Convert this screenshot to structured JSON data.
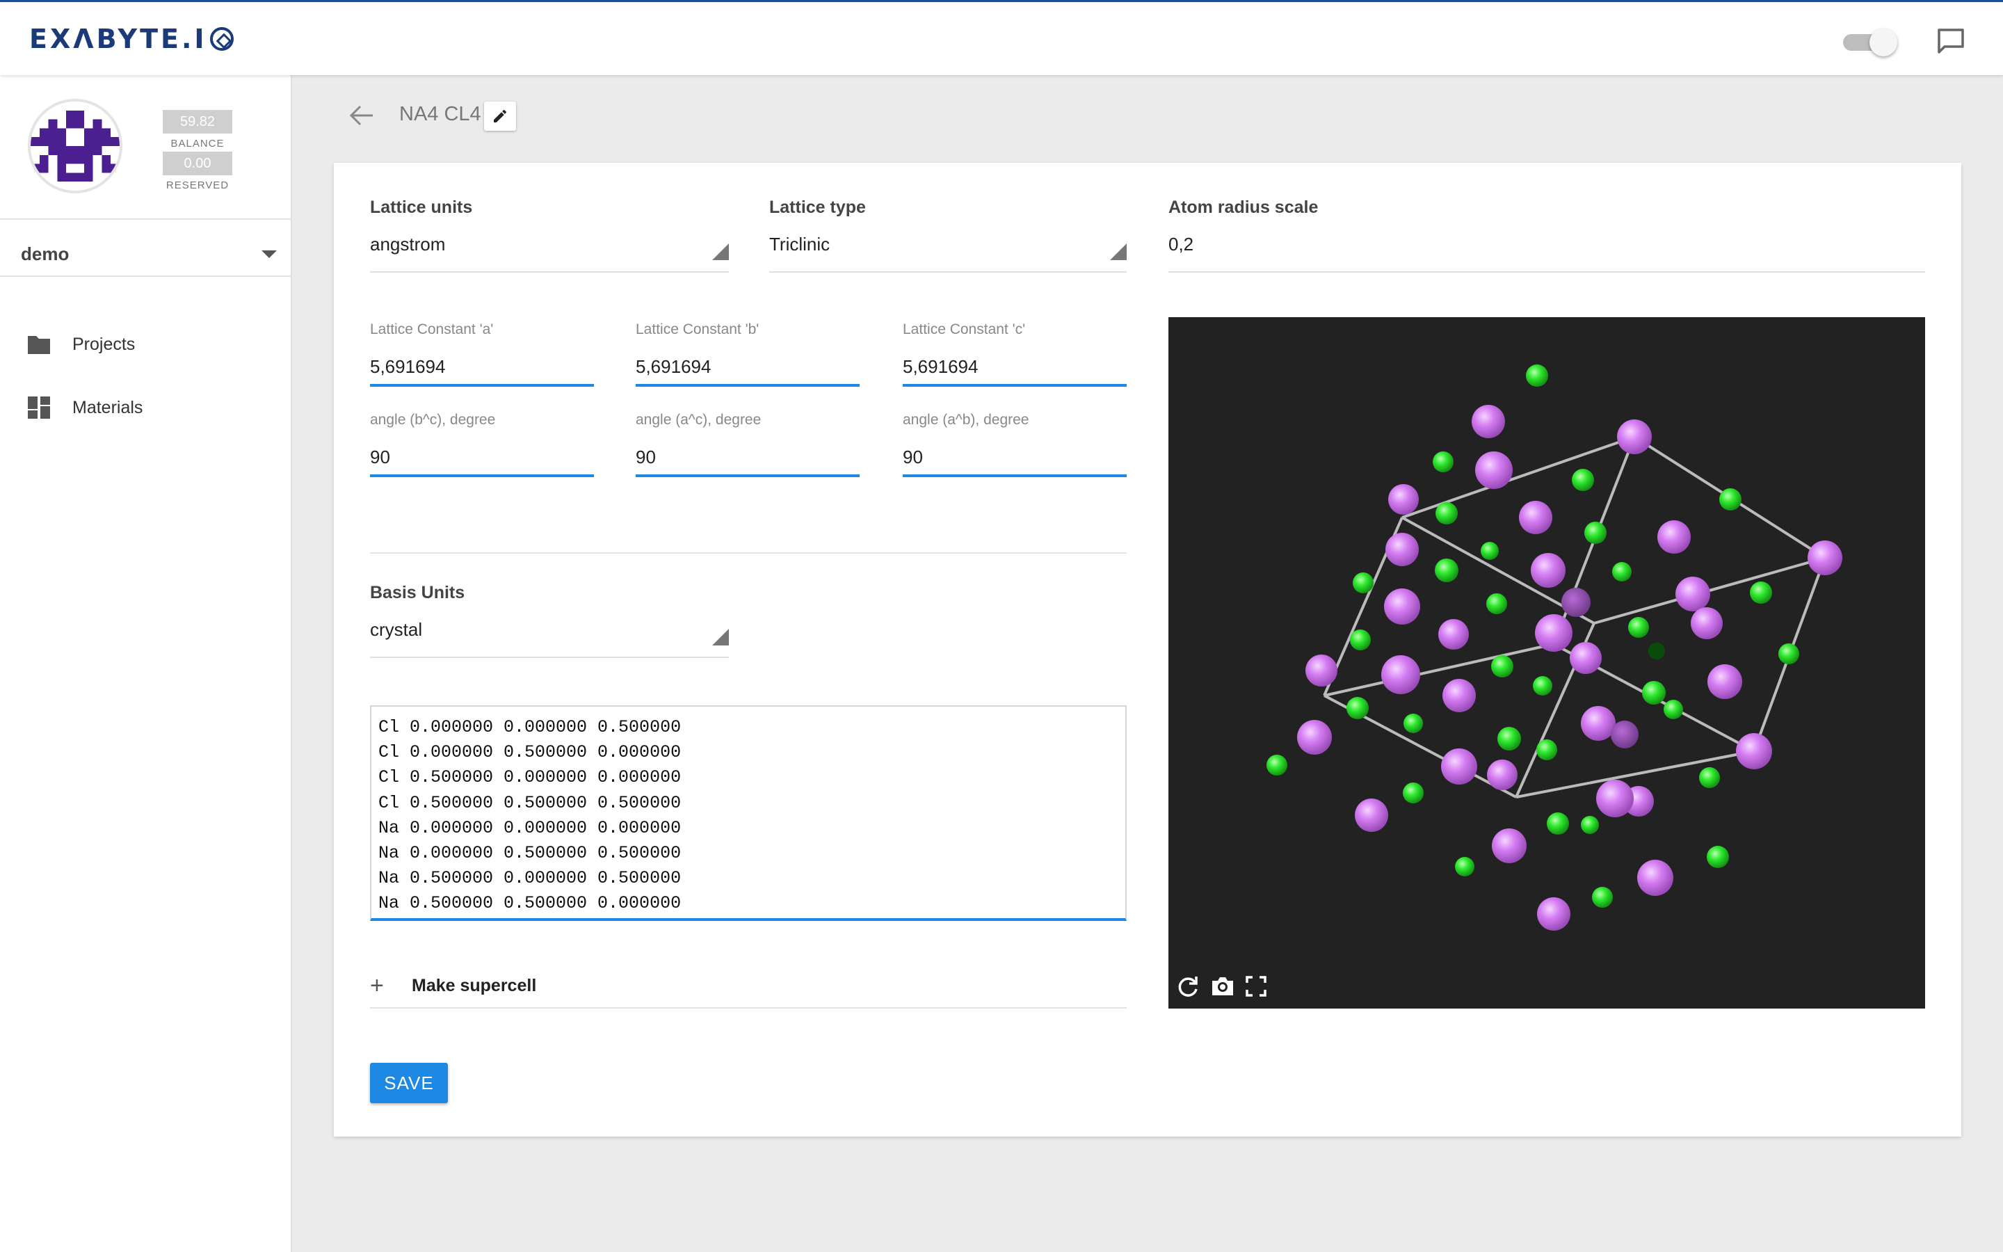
{
  "brand": {
    "logo_text": "EXΛBYTE.I"
  },
  "topbar": {
    "toggle_icon": "toggle-switch-icon",
    "chat_icon": "chat-bubble-icon"
  },
  "sidebar": {
    "balance_value": "59.82",
    "balance_label": "BALANCE",
    "reserved_value": "0.00",
    "reserved_label": "RESERVED",
    "account": "demo",
    "items": [
      {
        "label": "Projects",
        "icon": "folder-icon"
      },
      {
        "label": "Materials",
        "icon": "dashboard-icon"
      }
    ]
  },
  "header": {
    "title": "NA4 CL4"
  },
  "form": {
    "lattice_units_label": "Lattice units",
    "lattice_units_value": "angstrom",
    "lattice_type_label": "Lattice type",
    "lattice_type_value": "Triclinic",
    "atom_radius_label": "Atom radius scale",
    "atom_radius_value": "0,2",
    "constants": [
      {
        "label": "Lattice Constant 'a'",
        "value": "5,691694"
      },
      {
        "label": "Lattice Constant 'b'",
        "value": "5,691694"
      },
      {
        "label": "Lattice Constant 'c'",
        "value": "5,691694"
      }
    ],
    "angles": [
      {
        "label": "angle (b^c), degree",
        "value": "90"
      },
      {
        "label": "angle (a^c), degree",
        "value": "90"
      },
      {
        "label": "angle (a^b), degree",
        "value": "90"
      }
    ],
    "basis_units_label": "Basis Units",
    "basis_units_value": "crystal",
    "basis_text": "Cl 0.000000 0.000000 0.500000\nCl 0.000000 0.500000 0.000000\nCl 0.500000 0.000000 0.000000\nCl 0.500000 0.500000 0.500000\nNa 0.000000 0.000000 0.000000\nNa 0.000000 0.500000 0.500000\nNa 0.500000 0.000000 0.500000\nNa 0.500000 0.500000 0.000000",
    "supercell_label": "Make supercell",
    "save_label": "SAVE"
  },
  "viewer": {
    "colors": {
      "background": "#222222",
      "na_atom": "#d47cf2",
      "cl_atom": "#2de82d",
      "bond": "#bbbbbb"
    },
    "tools": [
      "rotate-icon",
      "camera-icon",
      "fullscreen-icon"
    ]
  }
}
